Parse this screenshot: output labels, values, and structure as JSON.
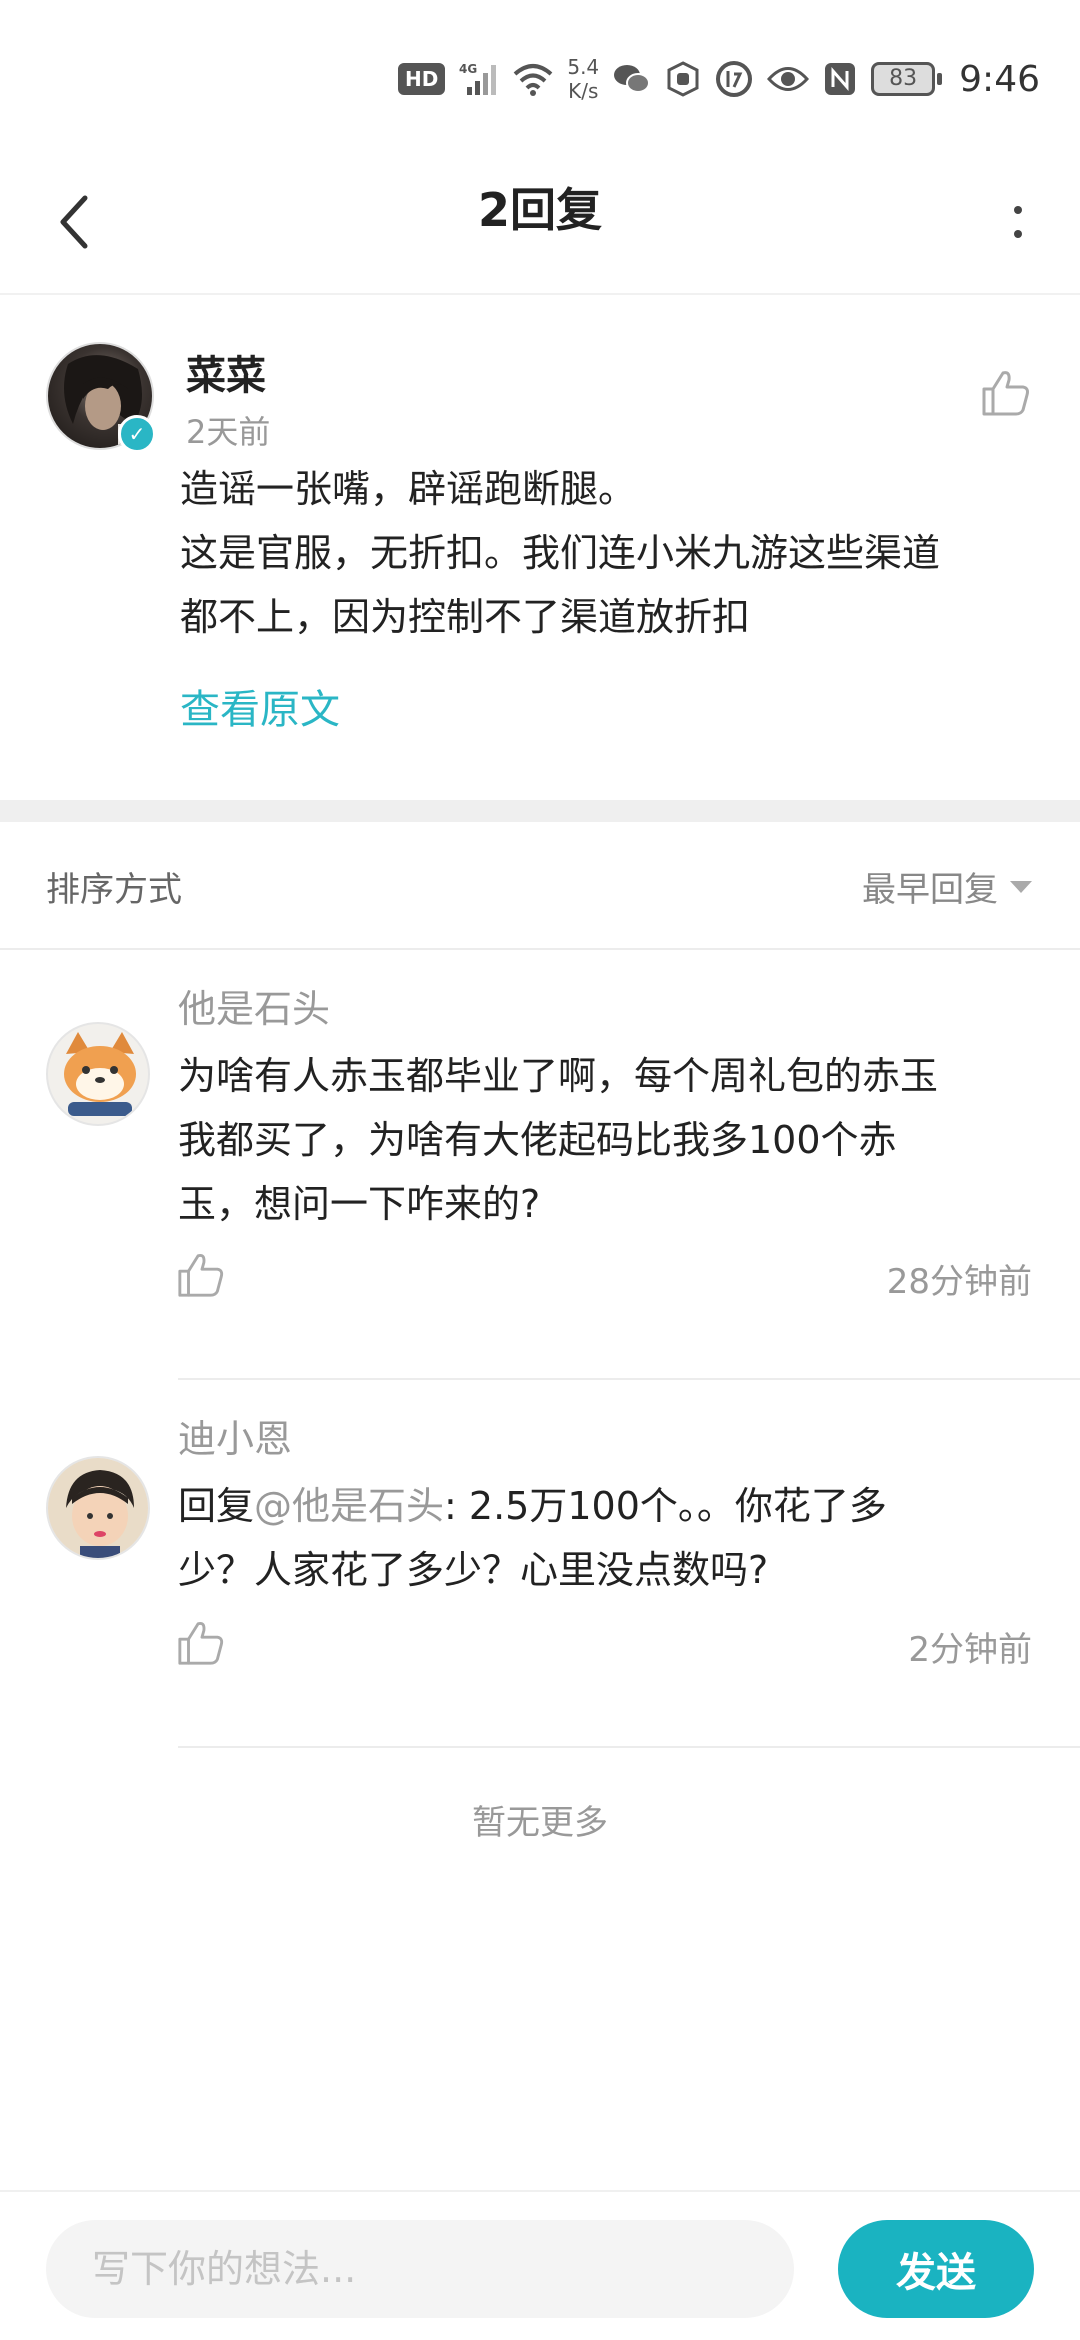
{
  "status_bar": {
    "hd": "HD",
    "network": "4G",
    "speed_value": "5.4",
    "speed_unit": "K/s",
    "battery": "83",
    "time": "9:46"
  },
  "header": {
    "title": "2回复"
  },
  "original": {
    "author": "菜菜",
    "time": "2天前",
    "lines": [
      "造谣一张嘴，辟谣跑断腿。",
      "这是官服，无折扣。我们连小米九游这些渠道",
      "都不上，因为控制不了渠道放折扣"
    ],
    "view_original": "查看原文"
  },
  "sort": {
    "label": "排序方式",
    "value": "最早回复"
  },
  "replies": [
    {
      "author": "他是石头",
      "lines": [
        "为啥有人赤玉都毕业了啊，每个周礼包的赤玉",
        "我都买了，为啥有大佬起码比我多100个赤",
        "玉，想问一下咋来的?"
      ],
      "time": "28分钟前"
    },
    {
      "author": "迪小恩",
      "reply_prefix": "回复",
      "mention": "@他是石头",
      "line1_rest": ":  2.5万100个。。你花了多",
      "line2": "少？人家花了多少？心里没点数吗?",
      "time": "2分钟前"
    }
  ],
  "no_more": "暂无更多",
  "composer": {
    "placeholder": "写下你的想法...",
    "send_label": "发送"
  },
  "colors": {
    "accent": "#1ab3c1",
    "link": "#2ab6c5"
  }
}
